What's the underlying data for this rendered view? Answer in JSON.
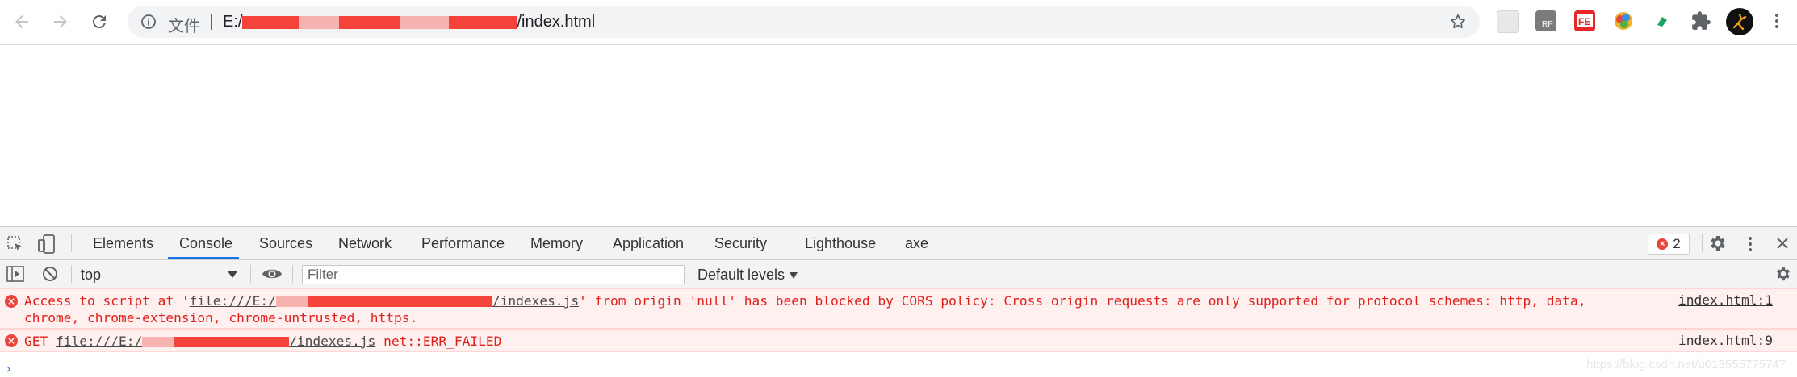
{
  "browser": {
    "url_scheme": "文件",
    "url_prefix": "E:/",
    "url_suffix": "/index.html"
  },
  "devtools": {
    "tabs": [
      "Elements",
      "Console",
      "Sources",
      "Network",
      "Performance",
      "Memory",
      "Application",
      "Security",
      "Lighthouse",
      "axe"
    ],
    "active_tab": "Console",
    "error_count": "2",
    "context": "top",
    "filter_placeholder": "Filter",
    "levels": "Default levels"
  },
  "console": {
    "messages": [
      {
        "part1": "Access to script at '",
        "link_prefix": "file:///E:/",
        "link_suffix": "/indexes.js",
        "part2": "' from origin 'null' has been blocked by CORS policy: Cross origin requests are only supported for protocol schemes: http, data,\nchrome, chrome-extension, chrome-untrusted, https.",
        "source": "index.html:1"
      },
      {
        "part1": "GET ",
        "link_prefix": "file:///E:/",
        "link_suffix": "/indexes.js",
        "part2": " net::ERR_FAILED",
        "source": "index.html:9"
      }
    ],
    "prompt": "›"
  },
  "watermark": "https://blog.csdn.net/u013555775747",
  "icons": {
    "back": "back-arrow-icon",
    "forward": "forward-arrow-icon",
    "reload": "reload-icon",
    "info": "info-icon",
    "star": "bookmark-star-icon",
    "error": "error-icon",
    "settings": "gear-icon",
    "close": "close-icon",
    "eye": "eye-icon",
    "clear": "block-icon"
  },
  "colors": {
    "error_text": "#e0201b",
    "error_bg": "#fff0f0",
    "accent": "#1a73e8",
    "redaction": "#f4433b"
  }
}
